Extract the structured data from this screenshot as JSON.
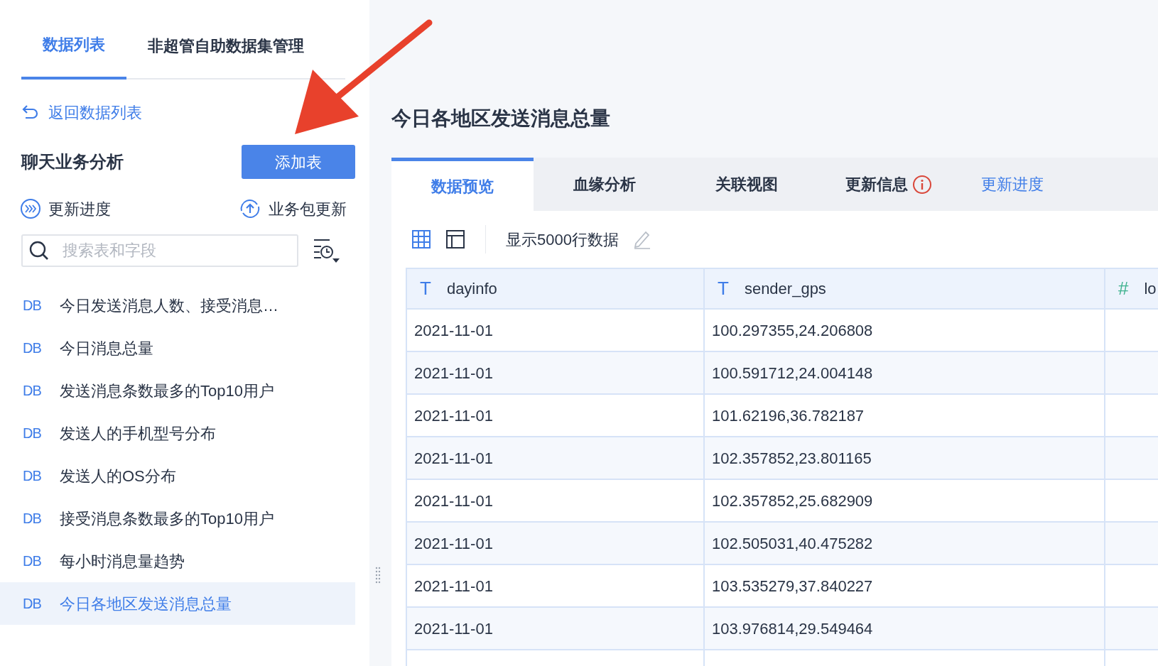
{
  "nav_tabs": [
    {
      "label": "数据列表",
      "selected": true
    },
    {
      "label": "非超管自助数据集管理",
      "selected": false
    }
  ],
  "back_link": "返回数据列表",
  "package": {
    "title": "聊天业务分析",
    "add_button": "添加表",
    "progress": "更新进度",
    "update": "业务包更新"
  },
  "search": {
    "placeholder": "搜索表和字段"
  },
  "tables": [
    {
      "badge": "DB",
      "label": "今日发送消息人数、接受消息…",
      "selected": false
    },
    {
      "badge": "DB",
      "label": "今日消息总量",
      "selected": false
    },
    {
      "badge": "DB",
      "label": "发送消息条数最多的Top10用户",
      "selected": false
    },
    {
      "badge": "DB",
      "label": "发送人的手机型号分布",
      "selected": false
    },
    {
      "badge": "DB",
      "label": "发送人的OS分布",
      "selected": false
    },
    {
      "badge": "DB",
      "label": "接受消息条数最多的Top10用户",
      "selected": false
    },
    {
      "badge": "DB",
      "label": "每小时消息量趋势",
      "selected": false
    },
    {
      "badge": "DB",
      "label": "今日各地区发送消息总量",
      "selected": true
    }
  ],
  "detail": {
    "title": "今日各地区发送消息总量",
    "tabs": [
      {
        "label": "数据预览",
        "selected": true,
        "alert": false
      },
      {
        "label": "血缘分析",
        "selected": false,
        "alert": false
      },
      {
        "label": "关联视图",
        "selected": false,
        "alert": false
      },
      {
        "label": "更新信息",
        "selected": false,
        "alert": true
      }
    ],
    "progress_link": "更新进度",
    "row_limit": "显示5000行数据",
    "columns": [
      {
        "kind": "text",
        "symbol": "T",
        "name": "dayinfo"
      },
      {
        "kind": "text",
        "symbol": "T",
        "name": "sender_gps"
      },
      {
        "kind": "number",
        "symbol": "#",
        "name": "lo"
      }
    ],
    "rows": [
      [
        "2021-11-01",
        "100.297355,24.206808"
      ],
      [
        "2021-11-01",
        "100.591712,24.004148"
      ],
      [
        "2021-11-01",
        "101.62196,36.782187"
      ],
      [
        "2021-11-01",
        "102.357852,23.801165"
      ],
      [
        "2021-11-01",
        "102.357852,25.682909"
      ],
      [
        "2021-11-01",
        "102.505031,40.475282"
      ],
      [
        "2021-11-01",
        "103.535279,37.840227"
      ],
      [
        "2021-11-01",
        "103.976814,29.549464"
      ]
    ]
  },
  "annotation": {
    "kind": "arrow"
  }
}
